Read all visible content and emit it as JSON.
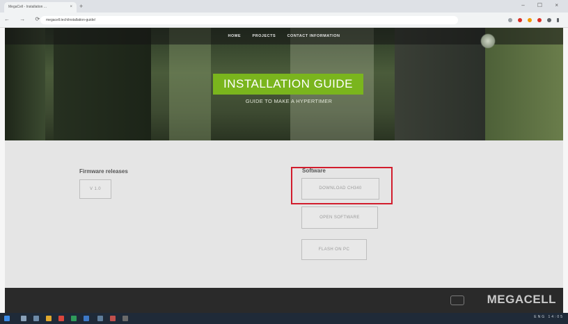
{
  "browser": {
    "tab_title": "MegaCell - Installation ...",
    "tab_close": "×",
    "new_tab": "+",
    "window_controls": "– ☐ ×",
    "nav_buttons": "← → ⟳",
    "url": "megacell.tech/installation-guide/"
  },
  "nav": {
    "items": [
      "HOME",
      "PROJECTS",
      "CONTACT INFORMATION"
    ]
  },
  "hero": {
    "title": "INSTALLATION GUIDE",
    "subtitle": "GUIDE TO MAKE A HYPERTIMER"
  },
  "firmware": {
    "title": "Firmware releases",
    "buttons": [
      "V 1.0"
    ]
  },
  "software": {
    "title": "Software",
    "buttons": [
      "DOWNLOAD CH340",
      "OPEN SOFTWARE",
      "FLASH ON PC"
    ]
  },
  "footer": {
    "logo": "MEGACELL"
  },
  "taskbar": {
    "tray_text": "ENG 14:05"
  },
  "colors": {
    "accent_green": "#7ab51d",
    "highlight_red": "#d21c2c",
    "footer_bg": "#2a2a2a"
  }
}
